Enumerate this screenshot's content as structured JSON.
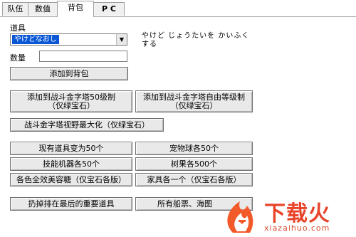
{
  "tabs": [
    {
      "label": "队伍"
    },
    {
      "label": "数值"
    },
    {
      "label": "背包"
    },
    {
      "label": "P C"
    }
  ],
  "item_section": {
    "label": "道具",
    "selected_item": "やけどなおし",
    "description": "やけど じょうたいを かいふく\nする"
  },
  "quantity": {
    "label": "数量",
    "value": ""
  },
  "buttons": {
    "add_to_bag": "添加到背包",
    "add_to_battle_tower_lv50": "添加到战斗金字塔50级制\n（仅绿宝石）",
    "add_to_battle_tower_free": "添加到战斗金字塔自由等级制\n（仅绿宝石）",
    "maximize_pyramid_view": "战斗金字塔视野最大化（仅绿宝石）",
    "items_to_50": "现有道具变为50个",
    "pokeballs_50": "宠物球各50个",
    "tms_50": "技能机器各50个",
    "berries_500": "树果各500个",
    "pokeblocks": "各色全效美容糖（仅宝石各版）",
    "furniture": "家具各一个（仅宝石各版）",
    "discarded_key_items": "扔掉排在最后的重要道具",
    "all_tickets": "所有船票、海图"
  },
  "watermark": {
    "name": "下载火",
    "domain": "xiazaihuo.com"
  }
}
